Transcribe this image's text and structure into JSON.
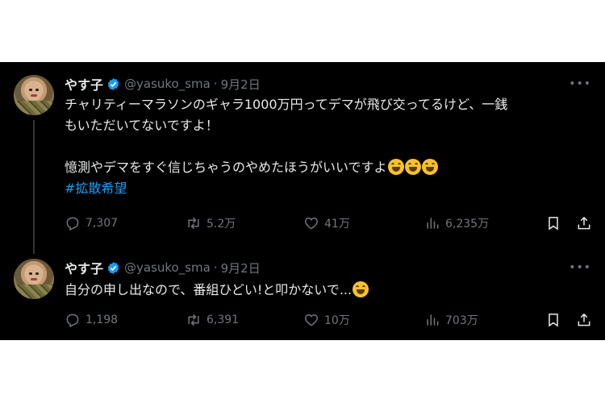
{
  "tweets": [
    {
      "name": "やす子",
      "handle": "@yasuko_sma",
      "separator": "·",
      "date": "9月2日",
      "line1": "チャリティーマラソンのギャラ1000万円ってデマが飛び交ってるけど、一銭",
      "line2": "もいただいてないですよ！",
      "line3": "憶測やデマをすぐ信じちゃうのやめたほうがいいですよ",
      "hashtag": "#拡散希望",
      "replies": "7,307",
      "retweets": "5.2万",
      "likes": "41万",
      "views": "6,235万"
    },
    {
      "name": "やす子",
      "handle": "@yasuko_sma",
      "separator": "·",
      "date": "9月2日",
      "line1": "自分の申し出なので、番組ひどい!と叩かないで...",
      "replies": "1,198",
      "retweets": "6,391",
      "likes": "10万",
      "views": "703万"
    }
  ],
  "icons": {
    "verified": "verified-badge-icon",
    "more": "more-icon",
    "reply": "reply-icon",
    "retweet": "retweet-icon",
    "like": "heart-icon",
    "views": "views-icon",
    "bookmark": "bookmark-icon",
    "share": "share-icon",
    "emoji": "grinning-squinting-face-icon"
  },
  "colors": {
    "background": "#000000",
    "text": "#e7e9ea",
    "muted": "#71767b",
    "link": "#1d9bf0",
    "verified": "#1d9bf0"
  }
}
